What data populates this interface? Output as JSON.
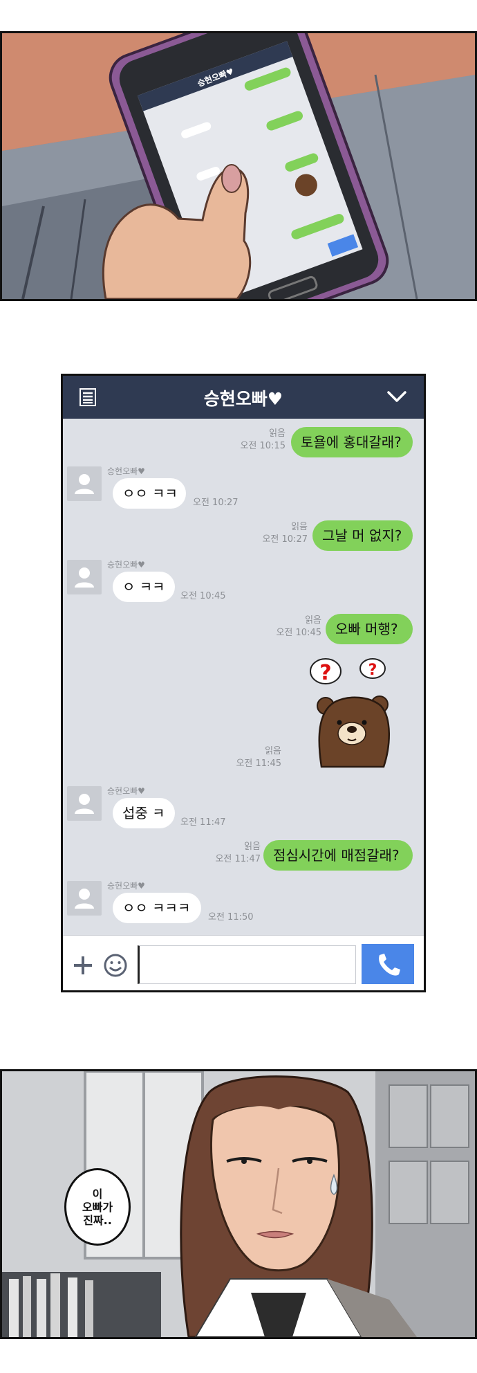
{
  "chat": {
    "title": "승현오빠♥",
    "contact_name": "승현오빠♥",
    "messages": [
      {
        "from": "me",
        "text": "토욜에 홍대갈래?",
        "read": "읽음",
        "time": "오전 10:15"
      },
      {
        "from": "them",
        "text": "ㅇㅇ ㅋㅋ",
        "time": "오전 10:27"
      },
      {
        "from": "me",
        "text": "그날 머 없지?",
        "read": "읽음",
        "time": "오전 10:27"
      },
      {
        "from": "them",
        "text": "ㅇ ㅋㅋ",
        "time": "오전 10:45"
      },
      {
        "from": "me",
        "text": "오빠 머행?",
        "read": "읽음",
        "time": "오전 10:45"
      },
      {
        "from": "me",
        "sticker": "confused-bear-sticker",
        "read": "읽음",
        "time": "오전 11:45"
      },
      {
        "from": "them",
        "text": "섭중 ㅋ",
        "time": "오전 11:47"
      },
      {
        "from": "me",
        "text": "점심시간에 매점갈래?",
        "read": "읽음",
        "time": "오전 11:47"
      },
      {
        "from": "them",
        "text": "ㅇㅇ ㅋㅋㅋ",
        "time": "오전 11:50"
      }
    ],
    "input_value": "",
    "colors": {
      "header": "#2f3a52",
      "background": "#dde0e6",
      "my_bubble": "#82d15a",
      "their_bubble": "#ffffff",
      "call_button": "#4a86e8"
    }
  },
  "speech_bubble": {
    "lines": [
      "이",
      "오빠가",
      "진짜.."
    ]
  },
  "icons": {
    "menu": "menu-icon",
    "dropdown": "chevron-down-icon",
    "add": "plus-icon",
    "emoji": "emoji-icon",
    "call": "phone-icon",
    "sticker_question": "question-mark-icon"
  }
}
